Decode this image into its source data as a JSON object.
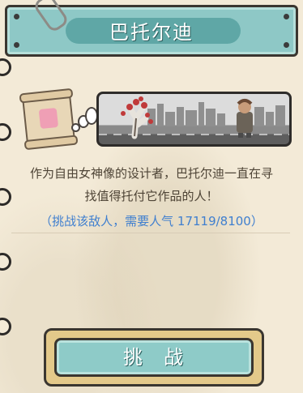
{
  "dialog": {
    "title": "巴托尔迪",
    "description_line1": "作为自由女神像的设计者，巴托尔迪一直在寻",
    "description_line2": "找值得托付它作品的人！",
    "challenge_info": "（挑战该敌人，需要人气 17119/8100）",
    "challenge_button_label": "挑战"
  },
  "icons": {
    "clip": "paperclip-icon",
    "scroll": "scroll-icon",
    "bubble": "thought-bubble-icon"
  },
  "colors": {
    "title_bar": "#8ec8c6",
    "challenge_text": "#3f7fcf",
    "button": "#8ecbc8"
  }
}
